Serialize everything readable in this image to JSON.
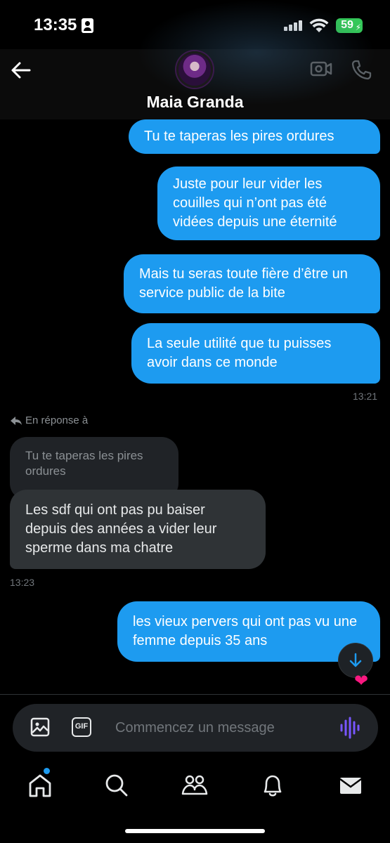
{
  "status_bar": {
    "time": "13:35",
    "battery": "59"
  },
  "header": {
    "contact_name": "Maia Granda"
  },
  "messages_out_top": [
    "Tu te taperas les pires ordures",
    "Juste pour leur vider les couilles qui n’ont pas été vidées depuis une éternité",
    "Mais tu seras toute fière d’être un service public de la bite",
    "La seule utilité que tu puisses avoir dans ce monde"
  ],
  "time_out_1": "13:21",
  "reply": {
    "label": "En réponse à",
    "quoted": "Tu te taperas les pires ordures",
    "message": "Les sdf qui ont pas pu baiser depuis des années a vider leur sperme dans ma chatre",
    "time": "13:23"
  },
  "last_message": "les vieux pervers qui ont pas vu une femme depuis 35 ans",
  "composer": {
    "placeholder": "Commencez un message"
  },
  "icons": {
    "back": "back-arrow-icon",
    "video": "video-call-icon",
    "phone": "phone-icon",
    "image": "image-icon",
    "gif": "GIF",
    "voice": "voice-message-icon",
    "nav": [
      "home-icon",
      "search-icon",
      "communities-icon",
      "notifications-icon",
      "messages-icon"
    ]
  },
  "colors": {
    "accent": "#1d9bf0",
    "incoming": "#2f3336",
    "background": "#000000",
    "heart": "#f91880"
  }
}
